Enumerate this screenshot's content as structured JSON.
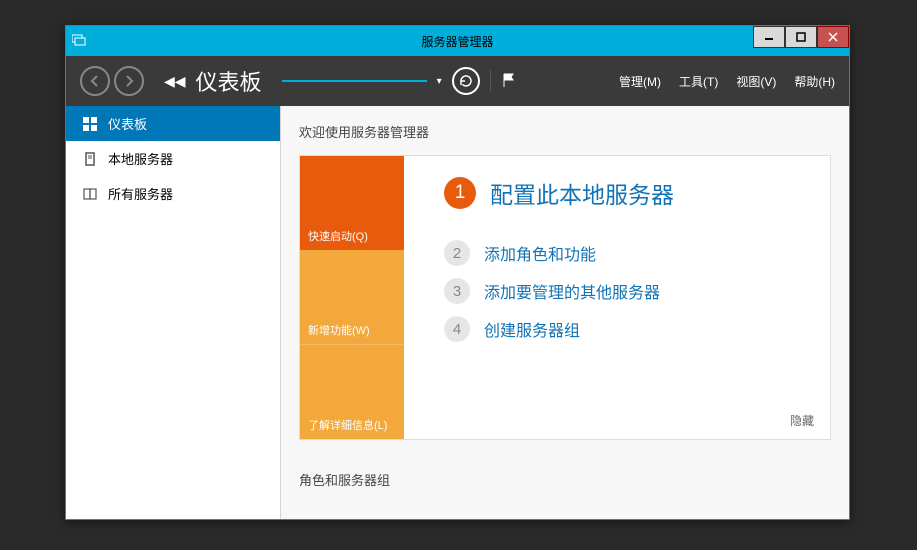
{
  "window": {
    "title": "服务器管理器"
  },
  "toolbar": {
    "breadcrumb": "仪表板",
    "menus": {
      "manage": "管理(M)",
      "tools": "工具(T)",
      "view": "视图(V)",
      "help": "帮助(H)"
    }
  },
  "sidebar": {
    "items": [
      {
        "label": "仪表板"
      },
      {
        "label": "本地服务器"
      },
      {
        "label": "所有服务器"
      }
    ]
  },
  "main": {
    "welcome": "欢迎使用服务器管理器",
    "tabs": {
      "quickstart": "快速启动(Q)",
      "whatsnew": "新增功能(W)",
      "learnmore": "了解详细信息(L)"
    },
    "steps": {
      "s1": {
        "num": "1",
        "label": "配置此本地服务器"
      },
      "s2": {
        "num": "2",
        "label": "添加角色和功能"
      },
      "s3": {
        "num": "3",
        "label": "添加要管理的其他服务器"
      },
      "s4": {
        "num": "4",
        "label": "创建服务器组"
      }
    },
    "hide": "隐藏",
    "section2": "角色和服务器组"
  }
}
